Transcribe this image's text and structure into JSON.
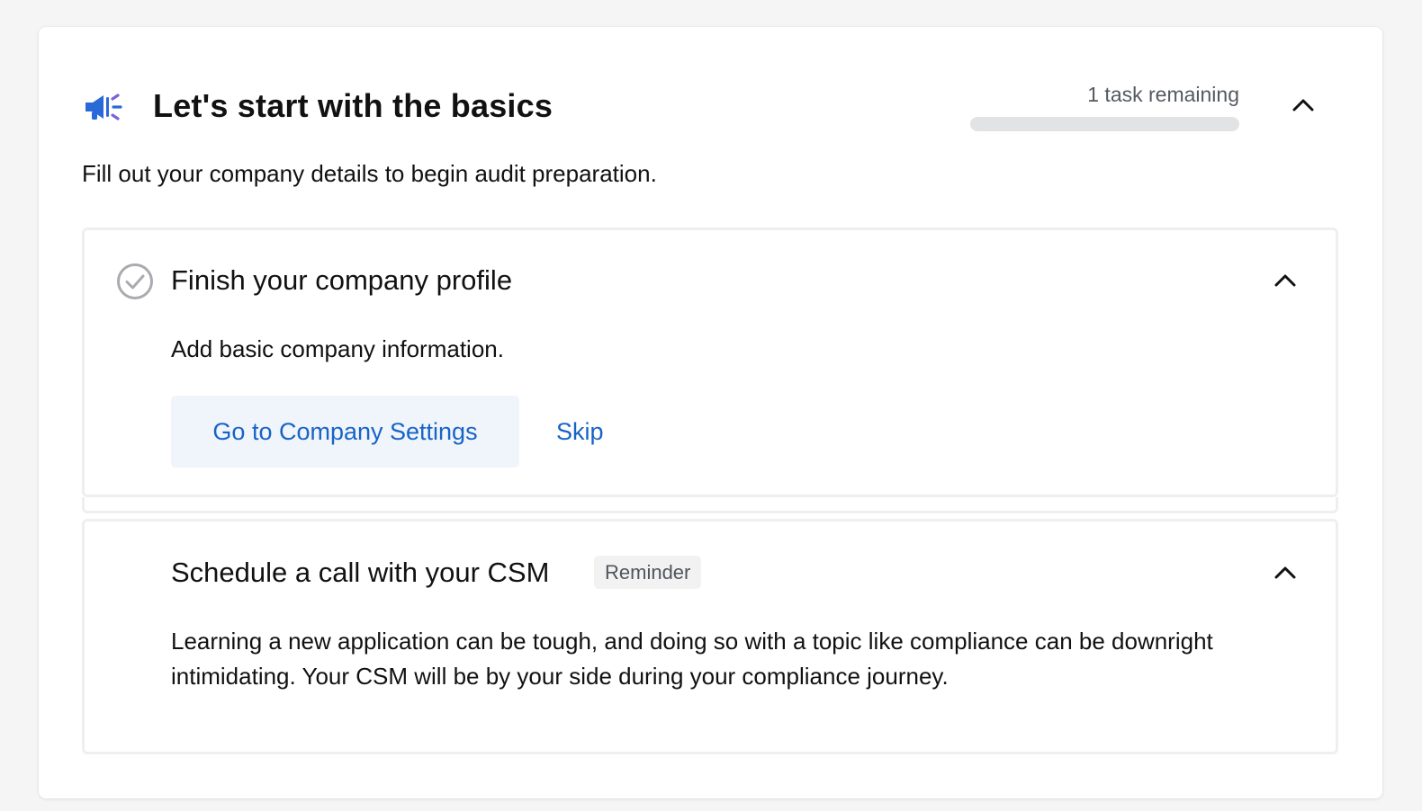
{
  "header": {
    "icon": "megaphone-icon",
    "title": "Let's start with the basics",
    "tasks_remaining": "1 task remaining",
    "progress_fraction": 0,
    "collapse_icon": "chevron-up-icon"
  },
  "subtitle": "Fill out your company details to begin audit preparation.",
  "tasks": [
    {
      "icon": "check-circle-icon",
      "title": "Finish your company profile",
      "description": "Add basic company information.",
      "primary_action": "Go to Company Settings",
      "secondary_action": "Skip",
      "collapse_icon": "chevron-up-icon"
    },
    {
      "title": "Schedule a call with your CSM",
      "badge": "Reminder",
      "description": "Learning a new application can be tough, and doing so with a topic like compliance can be downright intimidating. Your CSM will be by your side during your compliance journey.",
      "collapse_icon": "chevron-up-icon"
    }
  ],
  "colors": {
    "accent": "#1763c6",
    "icon_blue": "#2a6ad8",
    "icon_purple": "#7b61d9",
    "progress_track": "#e2e3e5",
    "primary_button_bg": "#f0f5fb",
    "border": "#efeff1"
  }
}
